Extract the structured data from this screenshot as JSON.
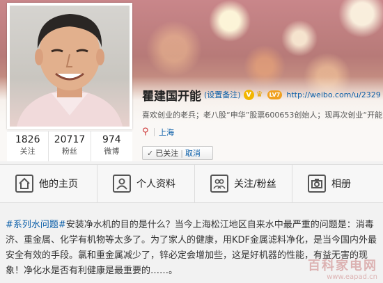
{
  "profile": {
    "name": "瞿建国开能",
    "remark": "(设置备注)",
    "vip_mark": "V",
    "level": "LV7",
    "url": "http://weibo.com/u/2329",
    "bio": "喜欢创业的老兵；老八股“申华”股票600653创始人；现再次创业“开能”",
    "location": "上海",
    "follow_status": "已关注",
    "cancel_label": "取消"
  },
  "counts": [
    {
      "num": "1826",
      "label": "关注"
    },
    {
      "num": "20717",
      "label": "粉丝"
    },
    {
      "num": "974",
      "label": "微博"
    }
  ],
  "tabs": [
    {
      "label": "他的主页",
      "icon": "home-icon"
    },
    {
      "label": "个人资料",
      "icon": "person-icon"
    },
    {
      "label": "关注/粉丝",
      "icon": "people-icon"
    },
    {
      "label": "相册",
      "icon": "camera-icon"
    }
  ],
  "post": {
    "topic": "#系列水问题#",
    "text": "安装净水机的目的是什么？当今上海松江地区自来水中最严重的问题是：消毒济、重金属、化学有机物等太多了。为了家人的健康，用KDF金属滤料净化，是当今国内外最安全有效的手段。氯和重金属减少了，锌必定会增加些，这是好机器的性能，有益无害的现象！净化水是否有利健康是最重要的……。"
  },
  "watermark": {
    "line1": "百科家电网",
    "line2": "www.eapad.cn"
  },
  "colors": {
    "link": "#0a5ea8",
    "vip_badge": "#f2b500",
    "level_badge": "#f0a020"
  }
}
